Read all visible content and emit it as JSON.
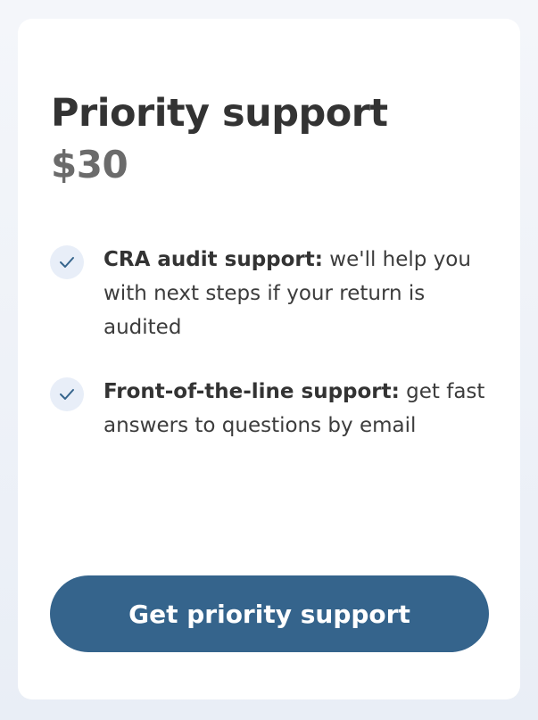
{
  "card": {
    "title": "Priority support",
    "price": "$30",
    "features": [
      {
        "icon": "check-icon",
        "bold": "CRA audit support:",
        "text": " we'll help you with next steps if your return is audited"
      },
      {
        "icon": "check-icon",
        "bold": "Front-of-the-line support:",
        "text": " get fast answers to questions by email"
      }
    ],
    "cta_label": "Get priority support"
  },
  "colors": {
    "background": "#eef2f8",
    "card": "#ffffff",
    "title": "#333333",
    "price": "#6b6b6b",
    "check_bg": "#e8eef8",
    "check_mark": "#35648c",
    "button": "#35648c",
    "button_text": "#ffffff"
  }
}
